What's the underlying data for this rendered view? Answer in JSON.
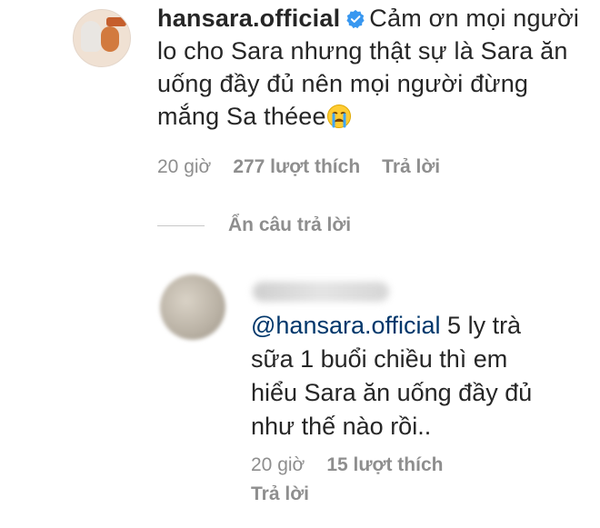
{
  "main_comment": {
    "username": "hansara.official",
    "text_line1": "Cảm ơn mọi",
    "text_rest": "người lo cho Sara nhưng thật sự là Sara ăn uống đầy đủ nên mọi người đừng mắng Sa théee",
    "emoji": "crying-face",
    "time": "20 giờ",
    "likes": "277 lượt thích",
    "reply_label": "Trả lời"
  },
  "hide_replies_label": "Ẩn câu trả lời",
  "reply": {
    "mention": "@hansara.official",
    "text": "5 ly trà sữa 1 buổi chiều thì em hiểu Sara ăn uống đầy đủ như thế nào rồi..",
    "time": "20 giờ",
    "likes": "15 lượt thích",
    "reply_label": "Trả lời"
  },
  "colors": {
    "text": "#262626",
    "secondary": "#8e8e8e",
    "mention": "#00376b",
    "verified": "#3897f0"
  }
}
